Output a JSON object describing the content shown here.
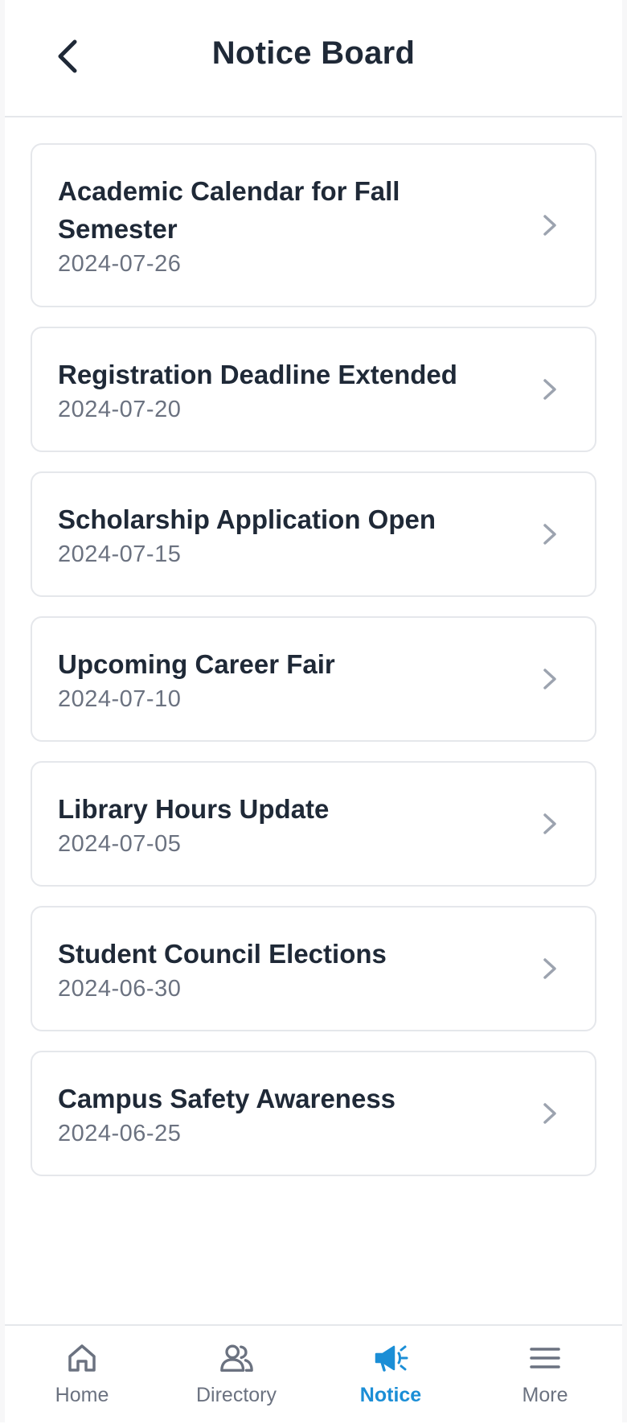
{
  "header": {
    "title": "Notice Board",
    "back_icon": "chevron-left-icon"
  },
  "notices": [
    {
      "title": "Academic Calendar for Fall Semester",
      "date": "2024-07-26"
    },
    {
      "title": "Registration Deadline Extended",
      "date": "2024-07-20"
    },
    {
      "title": "Scholarship Application Open",
      "date": "2024-07-15"
    },
    {
      "title": "Upcoming Career Fair",
      "date": "2024-07-10"
    },
    {
      "title": "Library Hours Update",
      "date": "2024-07-05"
    },
    {
      "title": "Student Council Elections",
      "date": "2024-06-30"
    },
    {
      "title": "Campus Safety Awareness",
      "date": "2024-06-25"
    }
  ],
  "bottom_nav": {
    "items": [
      {
        "label": "Home",
        "icon": "home-icon",
        "active": false
      },
      {
        "label": "Directory",
        "icon": "users-icon",
        "active": false
      },
      {
        "label": "Notice",
        "icon": "megaphone-icon",
        "active": true
      },
      {
        "label": "More",
        "icon": "menu-icon",
        "active": false
      }
    ]
  },
  "colors": {
    "accent": "#1b8ed6",
    "text_primary": "#1f2937",
    "text_secondary": "#6b7280",
    "border": "#e5e7eb",
    "chevron": "#9ca3af"
  }
}
